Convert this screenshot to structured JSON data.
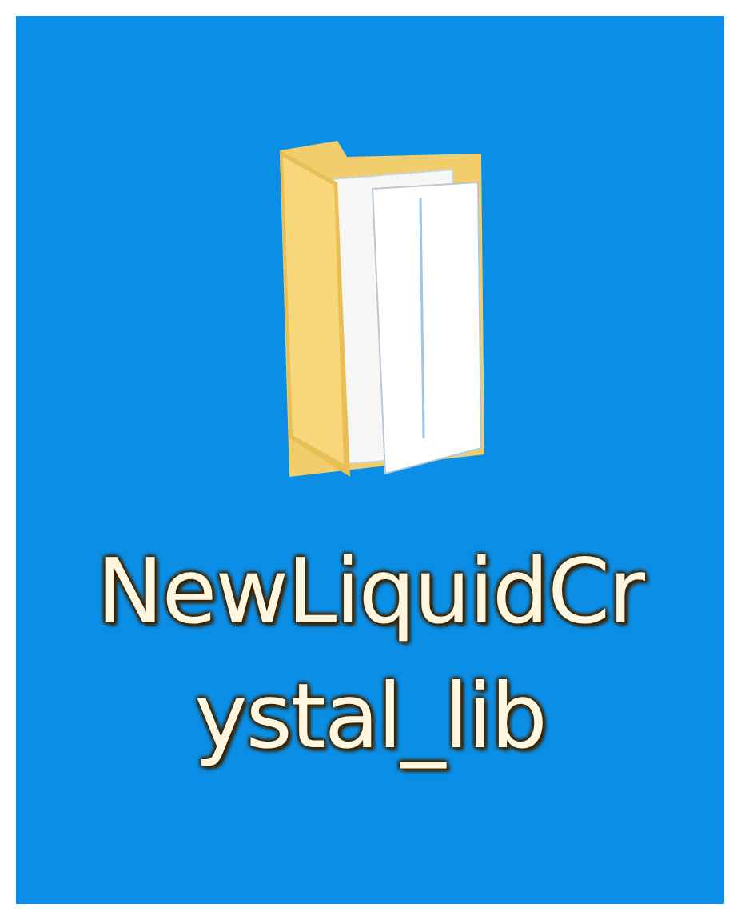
{
  "desktop_icon": {
    "label_lines": [
      "NewLiquidCr",
      "ystal_lib"
    ]
  }
}
